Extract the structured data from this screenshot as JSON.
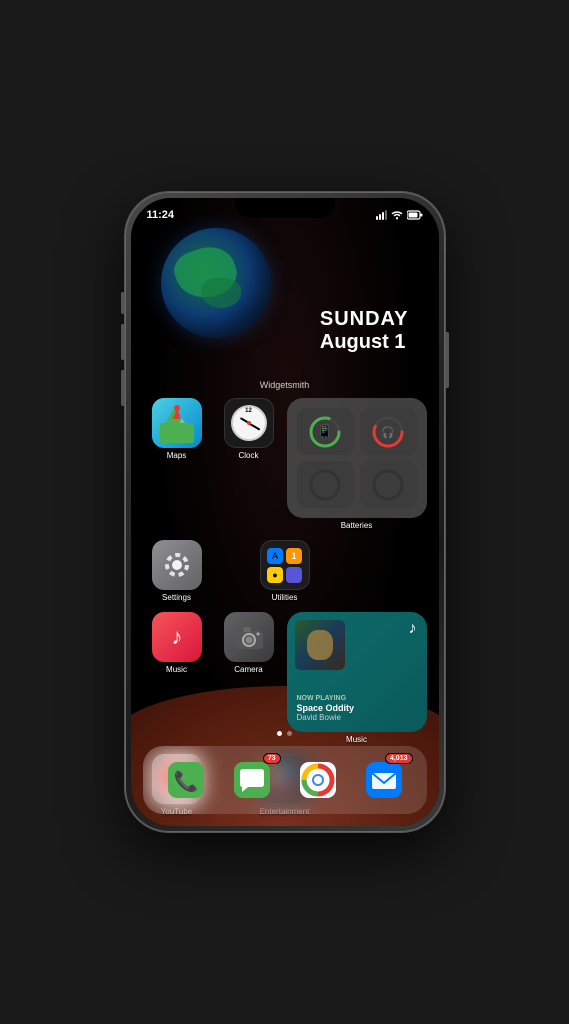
{
  "phone": {
    "statusBar": {
      "time": "11:24",
      "locationIcon": "◀",
      "signalBars": 3,
      "wifiIcon": "wifi",
      "batteryIcon": "battery"
    },
    "widget": {
      "earthLabel": "Widgetsmith",
      "day": "SUNDAY",
      "date": "August 1"
    },
    "apps": {
      "row1": [
        {
          "name": "Maps",
          "icon": "maps"
        },
        {
          "name": "Clock",
          "icon": "clock"
        }
      ],
      "row1right": {
        "name": "Batteries",
        "label": "Batteries"
      },
      "row2": [
        {
          "name": "Settings",
          "icon": "settings"
        },
        {
          "name": "Utilities",
          "icon": "utilities"
        }
      ],
      "row3": [
        {
          "name": "Music",
          "icon": "music"
        },
        {
          "name": "Camera",
          "icon": "camera"
        }
      ],
      "row3right": {
        "nowPlaying": "NOW PLAYING",
        "song": "Space Oddity",
        "artist": "David Bowie",
        "label": "Music"
      },
      "row4": [
        {
          "name": "YouTube",
          "icon": "youtube"
        },
        {
          "name": "Entertainment",
          "icon": "folder"
        }
      ]
    },
    "dock": [
      {
        "name": "Phone",
        "icon": "phone",
        "badge": null
      },
      {
        "name": "Messages",
        "icon": "messages",
        "badge": "73"
      },
      {
        "name": "Chrome",
        "icon": "chrome",
        "badge": null
      },
      {
        "name": "Mail",
        "icon": "mail",
        "badge": "4,013"
      }
    ]
  }
}
